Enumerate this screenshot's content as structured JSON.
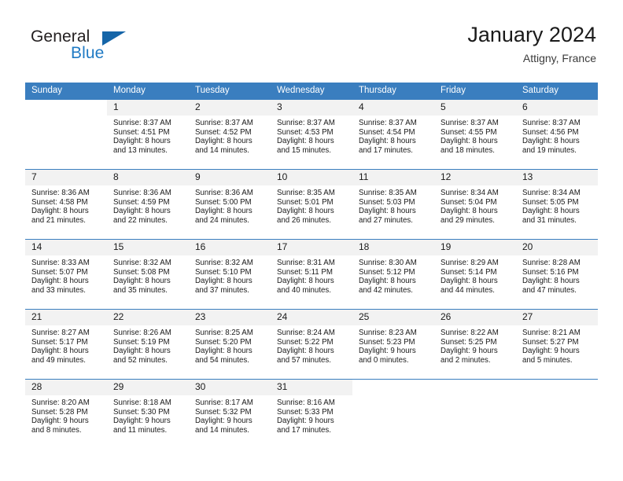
{
  "brand": {
    "name_part1": "General",
    "name_part2": "Blue",
    "triangle_color": "#1565a8",
    "blue_color": "#1f7ac4"
  },
  "header": {
    "title": "January 2024",
    "subtitle": "Attigny, France"
  },
  "theme": {
    "header_row_color": "#3a7ebf",
    "date_band_color": "#f2f2f2",
    "text_color": "#1a1a1a"
  },
  "weekdays": [
    "Sunday",
    "Monday",
    "Tuesday",
    "Wednesday",
    "Thursday",
    "Friday",
    "Saturday"
  ],
  "weeks": [
    [
      {
        "day": "",
        "sunrise": "",
        "sunset": "",
        "daylight_line1": "",
        "daylight_line2": ""
      },
      {
        "day": "1",
        "sunrise": "Sunrise: 8:37 AM",
        "sunset": "Sunset: 4:51 PM",
        "daylight_line1": "Daylight: 8 hours",
        "daylight_line2": "and 13 minutes."
      },
      {
        "day": "2",
        "sunrise": "Sunrise: 8:37 AM",
        "sunset": "Sunset: 4:52 PM",
        "daylight_line1": "Daylight: 8 hours",
        "daylight_line2": "and 14 minutes."
      },
      {
        "day": "3",
        "sunrise": "Sunrise: 8:37 AM",
        "sunset": "Sunset: 4:53 PM",
        "daylight_line1": "Daylight: 8 hours",
        "daylight_line2": "and 15 minutes."
      },
      {
        "day": "4",
        "sunrise": "Sunrise: 8:37 AM",
        "sunset": "Sunset: 4:54 PM",
        "daylight_line1": "Daylight: 8 hours",
        "daylight_line2": "and 17 minutes."
      },
      {
        "day": "5",
        "sunrise": "Sunrise: 8:37 AM",
        "sunset": "Sunset: 4:55 PM",
        "daylight_line1": "Daylight: 8 hours",
        "daylight_line2": "and 18 minutes."
      },
      {
        "day": "6",
        "sunrise": "Sunrise: 8:37 AM",
        "sunset": "Sunset: 4:56 PM",
        "daylight_line1": "Daylight: 8 hours",
        "daylight_line2": "and 19 minutes."
      }
    ],
    [
      {
        "day": "7",
        "sunrise": "Sunrise: 8:36 AM",
        "sunset": "Sunset: 4:58 PM",
        "daylight_line1": "Daylight: 8 hours",
        "daylight_line2": "and 21 minutes."
      },
      {
        "day": "8",
        "sunrise": "Sunrise: 8:36 AM",
        "sunset": "Sunset: 4:59 PM",
        "daylight_line1": "Daylight: 8 hours",
        "daylight_line2": "and 22 minutes."
      },
      {
        "day": "9",
        "sunrise": "Sunrise: 8:36 AM",
        "sunset": "Sunset: 5:00 PM",
        "daylight_line1": "Daylight: 8 hours",
        "daylight_line2": "and 24 minutes."
      },
      {
        "day": "10",
        "sunrise": "Sunrise: 8:35 AM",
        "sunset": "Sunset: 5:01 PM",
        "daylight_line1": "Daylight: 8 hours",
        "daylight_line2": "and 26 minutes."
      },
      {
        "day": "11",
        "sunrise": "Sunrise: 8:35 AM",
        "sunset": "Sunset: 5:03 PM",
        "daylight_line1": "Daylight: 8 hours",
        "daylight_line2": "and 27 minutes."
      },
      {
        "day": "12",
        "sunrise": "Sunrise: 8:34 AM",
        "sunset": "Sunset: 5:04 PM",
        "daylight_line1": "Daylight: 8 hours",
        "daylight_line2": "and 29 minutes."
      },
      {
        "day": "13",
        "sunrise": "Sunrise: 8:34 AM",
        "sunset": "Sunset: 5:05 PM",
        "daylight_line1": "Daylight: 8 hours",
        "daylight_line2": "and 31 minutes."
      }
    ],
    [
      {
        "day": "14",
        "sunrise": "Sunrise: 8:33 AM",
        "sunset": "Sunset: 5:07 PM",
        "daylight_line1": "Daylight: 8 hours",
        "daylight_line2": "and 33 minutes."
      },
      {
        "day": "15",
        "sunrise": "Sunrise: 8:32 AM",
        "sunset": "Sunset: 5:08 PM",
        "daylight_line1": "Daylight: 8 hours",
        "daylight_line2": "and 35 minutes."
      },
      {
        "day": "16",
        "sunrise": "Sunrise: 8:32 AM",
        "sunset": "Sunset: 5:10 PM",
        "daylight_line1": "Daylight: 8 hours",
        "daylight_line2": "and 37 minutes."
      },
      {
        "day": "17",
        "sunrise": "Sunrise: 8:31 AM",
        "sunset": "Sunset: 5:11 PM",
        "daylight_line1": "Daylight: 8 hours",
        "daylight_line2": "and 40 minutes."
      },
      {
        "day": "18",
        "sunrise": "Sunrise: 8:30 AM",
        "sunset": "Sunset: 5:12 PM",
        "daylight_line1": "Daylight: 8 hours",
        "daylight_line2": "and 42 minutes."
      },
      {
        "day": "19",
        "sunrise": "Sunrise: 8:29 AM",
        "sunset": "Sunset: 5:14 PM",
        "daylight_line1": "Daylight: 8 hours",
        "daylight_line2": "and 44 minutes."
      },
      {
        "day": "20",
        "sunrise": "Sunrise: 8:28 AM",
        "sunset": "Sunset: 5:16 PM",
        "daylight_line1": "Daylight: 8 hours",
        "daylight_line2": "and 47 minutes."
      }
    ],
    [
      {
        "day": "21",
        "sunrise": "Sunrise: 8:27 AM",
        "sunset": "Sunset: 5:17 PM",
        "daylight_line1": "Daylight: 8 hours",
        "daylight_line2": "and 49 minutes."
      },
      {
        "day": "22",
        "sunrise": "Sunrise: 8:26 AM",
        "sunset": "Sunset: 5:19 PM",
        "daylight_line1": "Daylight: 8 hours",
        "daylight_line2": "and 52 minutes."
      },
      {
        "day": "23",
        "sunrise": "Sunrise: 8:25 AM",
        "sunset": "Sunset: 5:20 PM",
        "daylight_line1": "Daylight: 8 hours",
        "daylight_line2": "and 54 minutes."
      },
      {
        "day": "24",
        "sunrise": "Sunrise: 8:24 AM",
        "sunset": "Sunset: 5:22 PM",
        "daylight_line1": "Daylight: 8 hours",
        "daylight_line2": "and 57 minutes."
      },
      {
        "day": "25",
        "sunrise": "Sunrise: 8:23 AM",
        "sunset": "Sunset: 5:23 PM",
        "daylight_line1": "Daylight: 9 hours",
        "daylight_line2": "and 0 minutes."
      },
      {
        "day": "26",
        "sunrise": "Sunrise: 8:22 AM",
        "sunset": "Sunset: 5:25 PM",
        "daylight_line1": "Daylight: 9 hours",
        "daylight_line2": "and 2 minutes."
      },
      {
        "day": "27",
        "sunrise": "Sunrise: 8:21 AM",
        "sunset": "Sunset: 5:27 PM",
        "daylight_line1": "Daylight: 9 hours",
        "daylight_line2": "and 5 minutes."
      }
    ],
    [
      {
        "day": "28",
        "sunrise": "Sunrise: 8:20 AM",
        "sunset": "Sunset: 5:28 PM",
        "daylight_line1": "Daylight: 9 hours",
        "daylight_line2": "and 8 minutes."
      },
      {
        "day": "29",
        "sunrise": "Sunrise: 8:18 AM",
        "sunset": "Sunset: 5:30 PM",
        "daylight_line1": "Daylight: 9 hours",
        "daylight_line2": "and 11 minutes."
      },
      {
        "day": "30",
        "sunrise": "Sunrise: 8:17 AM",
        "sunset": "Sunset: 5:32 PM",
        "daylight_line1": "Daylight: 9 hours",
        "daylight_line2": "and 14 minutes."
      },
      {
        "day": "31",
        "sunrise": "Sunrise: 8:16 AM",
        "sunset": "Sunset: 5:33 PM",
        "daylight_line1": "Daylight: 9 hours",
        "daylight_line2": "and 17 minutes."
      },
      {
        "day": "",
        "sunrise": "",
        "sunset": "",
        "daylight_line1": "",
        "daylight_line2": ""
      },
      {
        "day": "",
        "sunrise": "",
        "sunset": "",
        "daylight_line1": "",
        "daylight_line2": ""
      },
      {
        "day": "",
        "sunrise": "",
        "sunset": "",
        "daylight_line1": "",
        "daylight_line2": ""
      }
    ]
  ]
}
